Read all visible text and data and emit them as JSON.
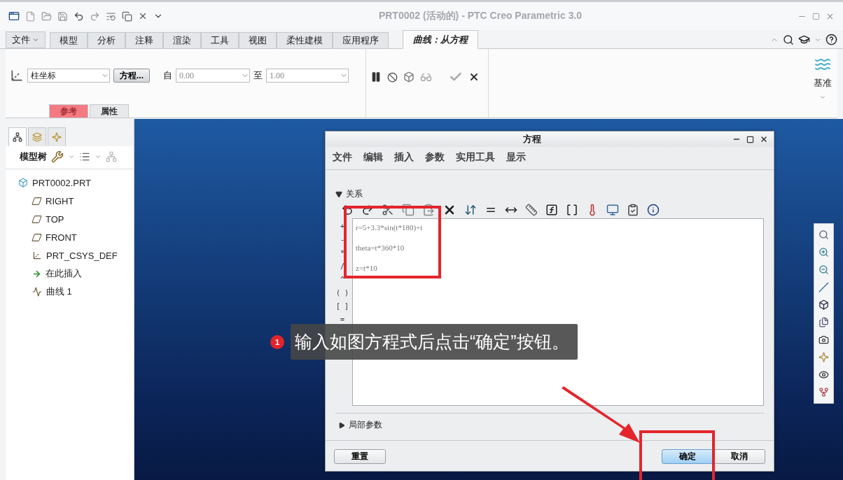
{
  "window": {
    "title": "PRT0002 (活动的) - PTC Creo Parametric 3.0"
  },
  "ribbon": {
    "file_menu": "文件",
    "tabs": [
      {
        "label": "模型",
        "selected": false
      },
      {
        "label": "分析",
        "selected": false
      },
      {
        "label": "注释",
        "selected": false
      },
      {
        "label": "渲染",
        "selected": false
      },
      {
        "label": "工具",
        "selected": false
      },
      {
        "label": "视图",
        "selected": false
      },
      {
        "label": "柔性建模",
        "selected": false
      },
      {
        "label": "应用程序",
        "selected": false
      },
      {
        "label": "曲线：从方程",
        "selected": true
      }
    ],
    "coord_type": "柱坐标",
    "equation_button": "方程...",
    "from_label": "自",
    "from_value": "0.00",
    "to_label": "至",
    "to_value": "1.00",
    "subtabs": [
      {
        "label": "参考",
        "attention": true
      },
      {
        "label": "属性",
        "attention": false
      }
    ],
    "datum_label": "基准"
  },
  "model_tree": {
    "tabs": [
      {
        "selected": true
      },
      {
        "selected": false
      },
      {
        "selected": false
      }
    ],
    "label": "模型树",
    "items": [
      {
        "label": "PRT0002.PRT",
        "kind": "part",
        "children": [
          {
            "label": "RIGHT",
            "kind": "plane"
          },
          {
            "label": "TOP",
            "kind": "plane"
          },
          {
            "label": "FRONT",
            "kind": "plane"
          },
          {
            "label": "PRT_CSYS_DEF",
            "kind": "csys"
          },
          {
            "label": "在此插入",
            "kind": "insert"
          },
          {
            "label": "曲线 1",
            "kind": "curve"
          }
        ]
      }
    ]
  },
  "dialog": {
    "title": "方程",
    "menu": [
      "文件",
      "编辑",
      "插入",
      "参数",
      "实用工具",
      "显示"
    ],
    "relations_label": "关系",
    "relations_expanded": true,
    "operators": [
      "+",
      "-",
      "*",
      "/",
      "^",
      "( )",
      "[ ]",
      "="
    ],
    "lines": [
      "r=5+3.3*sin(t*180)+t",
      "theta=t*360*10",
      "z=t*10"
    ],
    "local_params_label": "局部参数",
    "local_params_expanded": false,
    "buttons": [
      {
        "label": "重置",
        "kind": "normal"
      },
      {
        "label": "确定",
        "kind": "default"
      },
      {
        "label": "取消",
        "kind": "normal"
      }
    ]
  },
  "annotation": {
    "step": "1",
    "text": "输入如图方程式后点击“确定”按钮。"
  }
}
